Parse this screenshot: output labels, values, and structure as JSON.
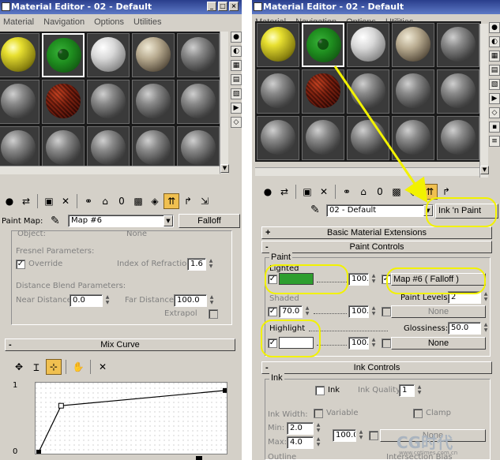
{
  "left_window": {
    "title": "Material Editor - 02 - Default",
    "menu": [
      "Material",
      "Navigation",
      "Options",
      "Utilities"
    ],
    "map_row": {
      "label": "Paint Map:",
      "map_name": "Map #6",
      "type_button": "Falloff"
    },
    "object_label": "Object:",
    "object_value": "None",
    "fresnel": {
      "group_label": "Fresnel Parameters:",
      "override_label": "Override",
      "override_checked": true,
      "ior_label": "Index of Refraction",
      "ior_value": "1.6"
    },
    "distance": {
      "group_label": "Distance Blend Parameters:",
      "near_label": "Near Distance:",
      "near_value": "0.0",
      "far_label": "Far Distance:",
      "far_value": "100.0",
      "extrapol_label": "Extrapol"
    },
    "mix_curve": {
      "title": "Mix Curve",
      "y_max_label": "1",
      "y_min_label": "0",
      "points": [
        [
          0.0,
          0.0
        ],
        [
          0.12,
          0.7
        ],
        [
          1.0,
          0.93
        ]
      ]
    }
  },
  "right_window": {
    "title": "Material Editor - 02 - Default",
    "menu": [
      "Material",
      "Navigation",
      "Options",
      "Utilities"
    ],
    "material_name": "02 - Default",
    "material_type": "Ink 'n Paint",
    "rollouts": {
      "basic": "Basic Material Extensions",
      "paint": "Paint Controls",
      "ink": "Ink Controls"
    },
    "paint": {
      "group_label": "Paint",
      "lighted_label": "Lighted",
      "lighted_color": "#2e9e2e",
      "lighted_amount": "100.0",
      "lighted_map": "Map #6    ( Falloff )",
      "paint_levels_label": "Paint Levels:",
      "paint_levels_value": "2",
      "shaded_label": "Shaded",
      "shaded_value": "70.0",
      "shaded_amount": "100.0",
      "shaded_map": "None",
      "highlight_label": "Highlight",
      "highlight_color": "#ffffff",
      "glossiness_label": "Glossiness:",
      "glossiness_value": "50.0",
      "highlight_amount": "100.0",
      "highlight_map": "None"
    },
    "ink": {
      "group_label": "Ink",
      "ink_label": "Ink",
      "ink_quality_label": "Ink Quality:",
      "ink_quality_value": "1",
      "ink_width_label": "Ink Width:",
      "variable_label": "Variable",
      "clamp_label": "Clamp",
      "min_label": "Min:",
      "min_value": "2.0",
      "max_label": "Max:",
      "max_value": "4.0",
      "amount_value": "100.0",
      "map": "None",
      "outline_label": "Outline",
      "intersection_label": "Intersection Bias"
    }
  },
  "watermark": "CG时代",
  "watermark_url": "www.cgtimes.com.cn",
  "colors": {
    "annotation": "#f2f200",
    "title_bar": "#2a3e8c"
  }
}
